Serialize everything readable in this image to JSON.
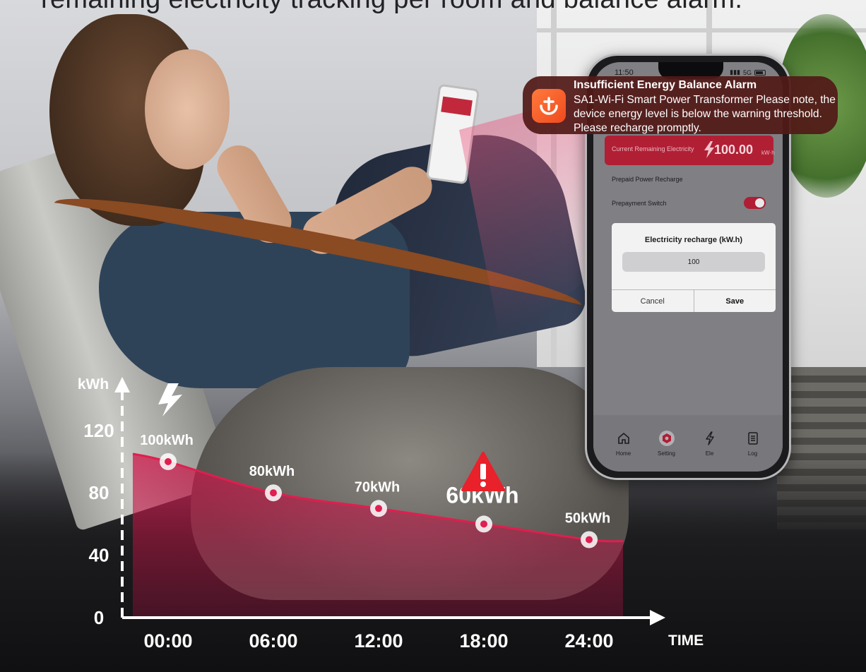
{
  "headline": "remaining electricity tracking per room and balance alarm.",
  "notification": {
    "title": "Insufficient Energy Balance Alarm",
    "body": "SA1-Wi-Fi Smart Power Transformer Please note, the device energy level is below the warning threshold. Please recharge promptly.",
    "icon": "tuya-app-icon"
  },
  "phone": {
    "status_time": "11:50",
    "network": "5G",
    "energy_card": {
      "label": "Current Remaining Electricity",
      "value": "100.00",
      "unit": "kW·h"
    },
    "rows": {
      "prepaid_recharge": "Prepaid Power Recharge",
      "prepayment_switch": "Prepayment Switch"
    },
    "prepayment_switch_on": true,
    "dialog": {
      "title": "Electricity recharge (kW.h)",
      "input_value": "100",
      "cancel_label": "Cancel",
      "save_label": "Save"
    },
    "tabs": [
      {
        "label": "Home",
        "icon": "home-icon"
      },
      {
        "label": "Setting",
        "icon": "setting-icon"
      },
      {
        "label": "Ele",
        "icon": "bolt-icon"
      },
      {
        "label": "Log",
        "icon": "log-icon"
      }
    ]
  },
  "colors": {
    "accent": "#e01e4f",
    "alarm": "#e8212b",
    "card": "#b11f35"
  },
  "chart_data": {
    "type": "area",
    "title": "",
    "xlabel": "TIME",
    "ylabel": "kWh",
    "categories": [
      "00:00",
      "06:00",
      "12:00",
      "18:00",
      "24:00"
    ],
    "values": [
      100,
      80,
      70,
      60,
      50
    ],
    "data_labels": [
      "100kWh",
      "80kWh",
      "70kWh",
      "60kWh",
      "50kWh"
    ],
    "alarm_index": 3,
    "y_ticks": [
      0,
      40,
      80,
      120
    ],
    "ylim": [
      0,
      130
    ]
  }
}
